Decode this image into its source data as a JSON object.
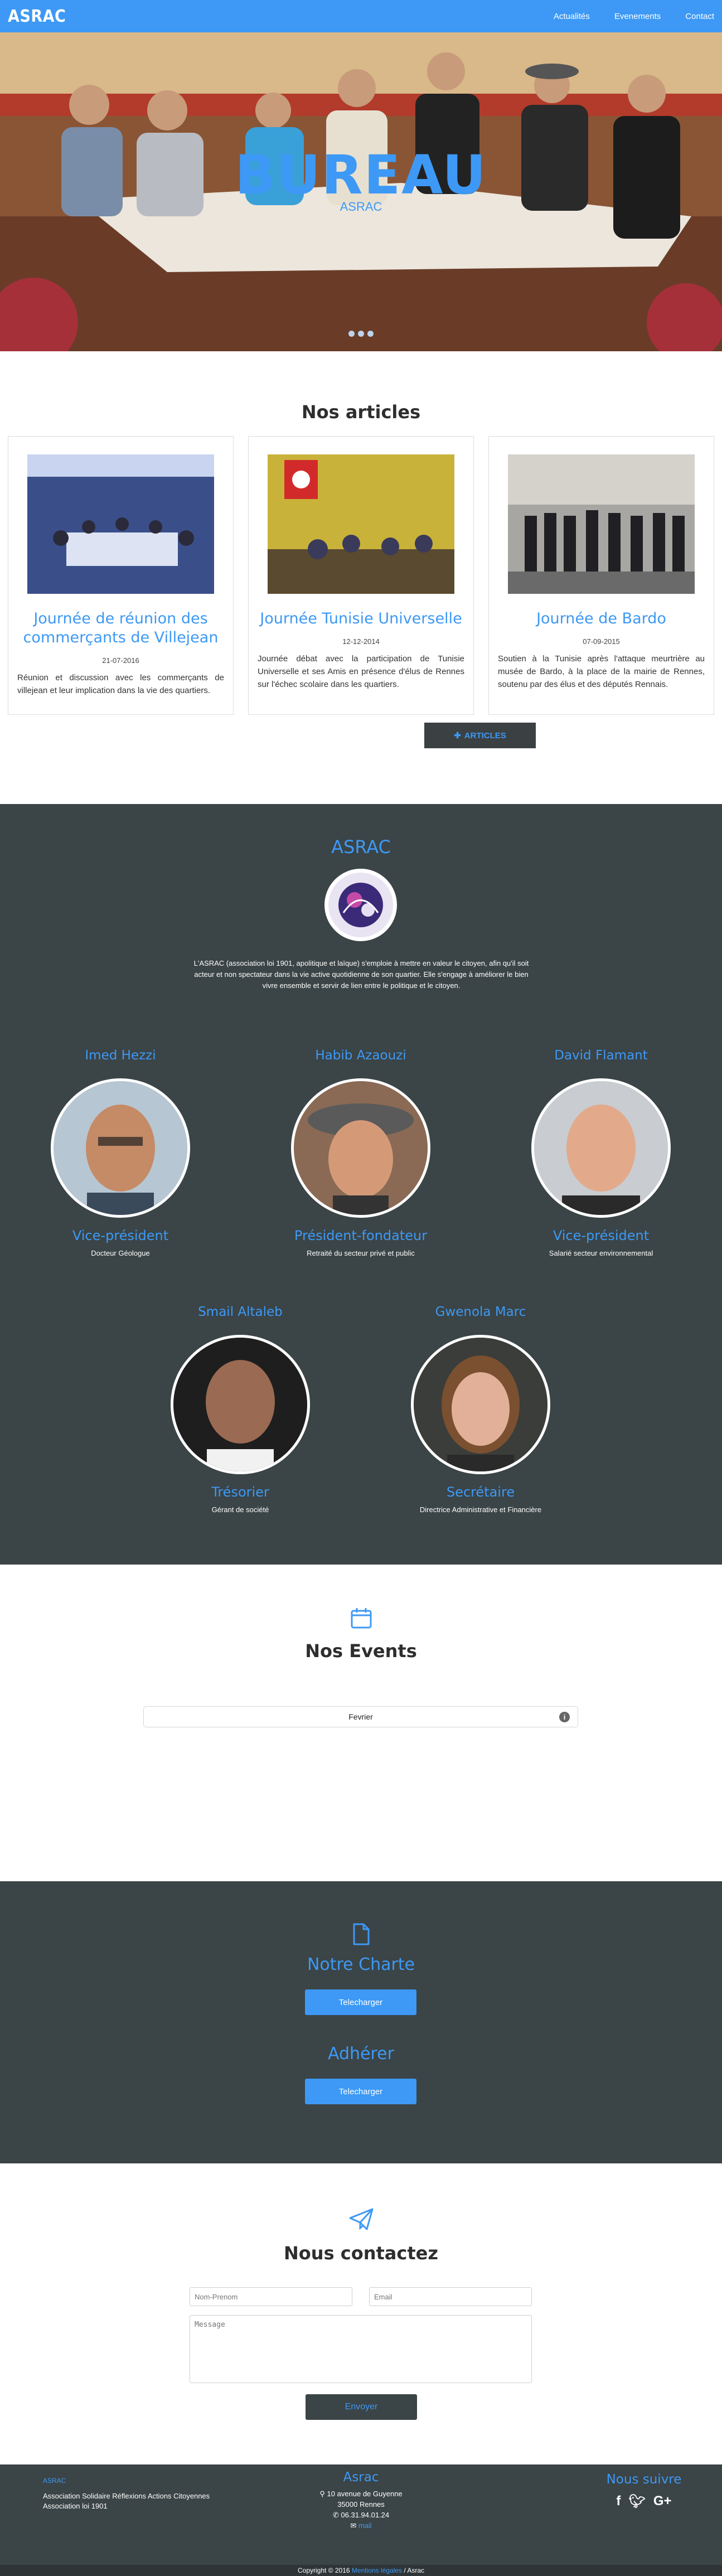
{
  "nav": {
    "brand": "ASRAC",
    "links": [
      "Actualités",
      "Evenements",
      "Contact"
    ]
  },
  "hero": {
    "title": "BUREAU",
    "subtitle": "ASRAC"
  },
  "articles": {
    "title": "Nos articles",
    "items": [
      {
        "title": "Journée de réunion des commerçants de Villejean",
        "date": "21-07-2016",
        "text": "Réunion et discussion avec les commerçants de villejean et leur implication dans la vie des quartiers."
      },
      {
        "title": "Journée Tunisie Universelle",
        "date": "12-12-2014",
        "text": "Journée débat avec la participation de Tunisie Universelle et ses Amis en présence d'élus de Rennes sur l'échec scolaire dans les quartiers."
      },
      {
        "title": "Journée de Bardo",
        "date": "07-09-2015",
        "text": "Soutien à la Tunisie après l'attaque meurtrière au musée de Bardo, à la place de la mairie de Rennes, soutenu par des élus et des députés Rennais."
      }
    ],
    "button": "ARTICLES"
  },
  "asrac": {
    "title": "ASRAC",
    "description": "L'ASRAC (association loi 1901, apolitique et laïque) s'emploie à mettre en valeur le citoyen, afin qu'il soit acteur et non spectateur dans la vie active quotidienne de son quartier. Elle s'engage à améliorer le bien vivre ensemble et servir de lien entre le politique et le citoyen.",
    "members": [
      {
        "name": "Imed Hezzi",
        "role": "Vice-président",
        "job": "Docteur Géologue"
      },
      {
        "name": "Habib Azaouzi",
        "role": "Président-fondateur",
        "job": "Retraité du secteur privé et public"
      },
      {
        "name": "David Flamant",
        "role": "Vice-président",
        "job": "Salarié secteur environnemental"
      },
      {
        "name": "Smail Altaleb",
        "role": "Trésorier",
        "job": "Gérant de société"
      },
      {
        "name": "Gwenola Marc",
        "role": "Secrétaire",
        "job": "Directrice Administrative et Financière"
      }
    ]
  },
  "events": {
    "title": "Nos Events",
    "month": "Fevrier"
  },
  "charte": {
    "title": "Notre Charte",
    "button": "Telecharger"
  },
  "adherer": {
    "title": "Adhérer",
    "button": "Telecharger"
  },
  "contact": {
    "title": "Nous contactez",
    "name_placeholder": "Nom-Prenom",
    "email_placeholder": "Email",
    "message_placeholder": "Message",
    "button": "Envoyer"
  },
  "footer": {
    "left_title": "ASRAC",
    "left_line1": "Association Solidaire Réflexions Actions Citoyennes",
    "left_line2": "Association loi 1901",
    "mid_title": "Asrac",
    "address1": "10 avenue de Guyenne",
    "address2": "35000 Rennes",
    "phone": "06.31.94.01.24",
    "mail": "mail",
    "right_title": "Nous suivre",
    "copyright_prefix": "Copyright © 2016",
    "copyright_link": "Mentions légales",
    "copyright_suffix": "/ Asrac"
  },
  "colors": {
    "accent": "#3d99f5",
    "dark": "#3b4446",
    "text": "#333333"
  }
}
